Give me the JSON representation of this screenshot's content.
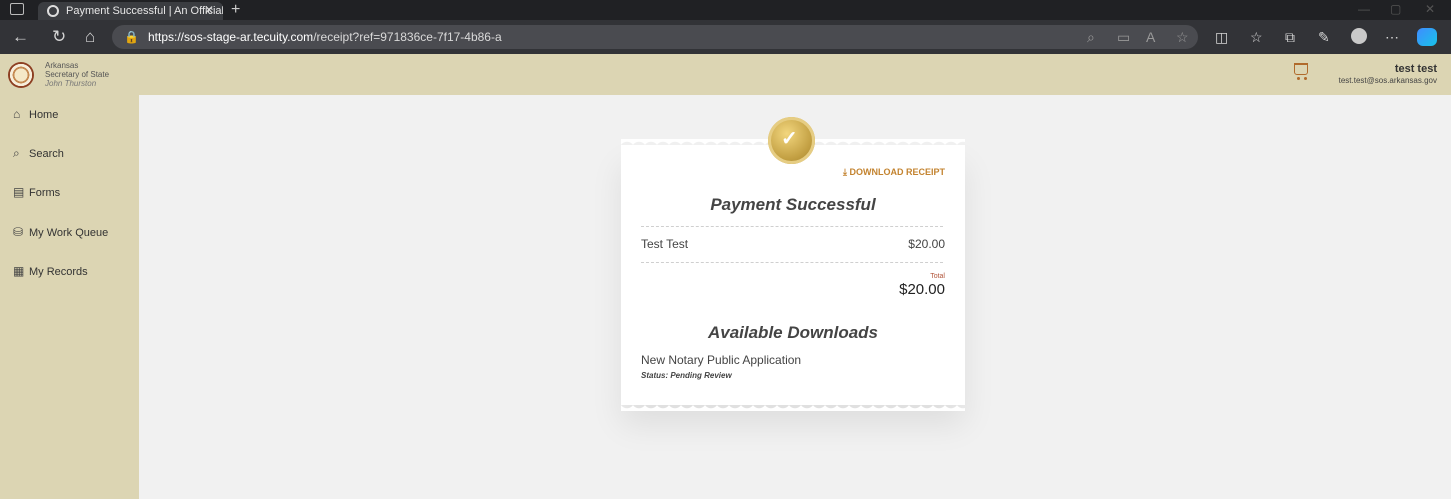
{
  "browser": {
    "tab_title": "Payment Successful | An Official",
    "tab_close": "✕",
    "new_tab": "+",
    "minimize": "—",
    "restore": "▢",
    "close": "✕",
    "url_host": "https://sos-stage-ar.tecuity.com",
    "url_path": "/receipt?ref=971836ce-7f17-4b86-a"
  },
  "header": {
    "org_line1": "Arkansas",
    "org_line2": "Secretary of State",
    "org_line3": "John Thurston",
    "user_name": "test test",
    "user_email": "test.test@sos.arkansas.gov"
  },
  "sidebar": {
    "items": [
      {
        "label": "Home",
        "icon": "⌂"
      },
      {
        "label": "Search",
        "icon": "⌕"
      },
      {
        "label": "Forms",
        "icon": "▤"
      },
      {
        "label": "My Work Queue",
        "icon": "⛁"
      },
      {
        "label": "My Records",
        "icon": "▦"
      }
    ]
  },
  "receipt": {
    "download_label": "DOWNLOAD RECEIPT",
    "title": "Payment Successful",
    "line_items": [
      {
        "name": "Test Test",
        "amount": "$20.00"
      }
    ],
    "total_label": "Total",
    "total_value": "$20.00",
    "downloads_title": "Available Downloads",
    "downloads": [
      {
        "name": "New Notary Public Application",
        "status": "Status: Pending Review"
      }
    ]
  },
  "colors": {
    "header_bg": "#dcd5b3",
    "accent_orange": "#c3832f",
    "badge_gold": "#c3a043"
  }
}
